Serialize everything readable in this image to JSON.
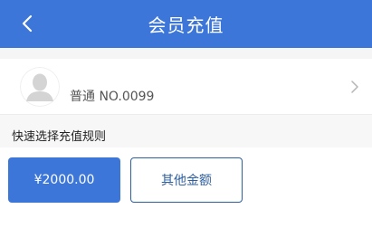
{
  "header": {
    "title": "会员充值",
    "back_icon": "chevron-left-icon"
  },
  "member": {
    "label": "普通 NO.0099",
    "avatar_icon": "default-avatar-icon",
    "chevron_icon": "chevron-right-icon"
  },
  "section": {
    "title": "快速选择充值规则"
  },
  "options": [
    {
      "label": "¥2000.00",
      "selected": true
    },
    {
      "label": "其他金额",
      "selected": false
    }
  ],
  "colors": {
    "primary": "#3c76d8",
    "outline": "#2e5f9e",
    "page_bg": "#f7f7f7"
  }
}
